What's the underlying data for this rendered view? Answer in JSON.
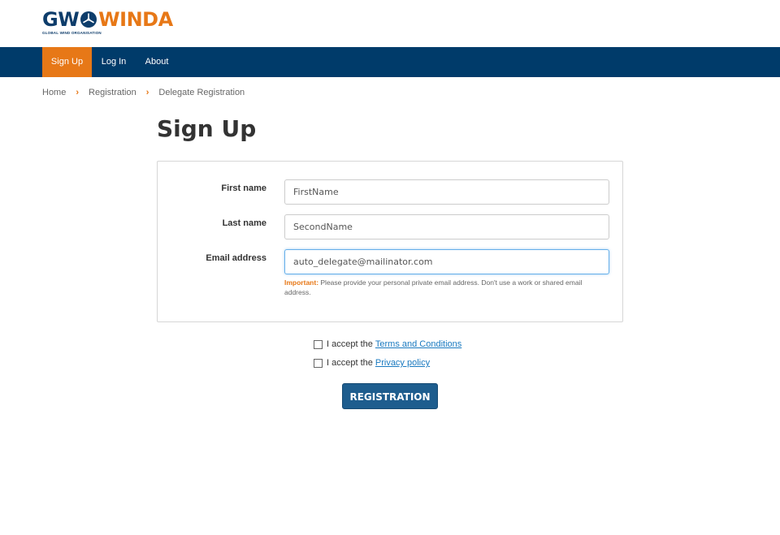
{
  "logo": {
    "part1": "GW",
    "part2": "WINDA",
    "tagline": "GLOBAL WIND ORGANISATION"
  },
  "nav": {
    "items": [
      {
        "label": "Sign Up",
        "active": true
      },
      {
        "label": "Log In",
        "active": false
      },
      {
        "label": "About",
        "active": false
      }
    ]
  },
  "breadcrumb": [
    "Home",
    "Registration",
    "Delegate Registration"
  ],
  "page": {
    "title": "Sign Up"
  },
  "form": {
    "first_name": {
      "label": "First name",
      "value": "FirstName"
    },
    "last_name": {
      "label": "Last name",
      "value": "SecondName"
    },
    "email": {
      "label": "Email address",
      "value": "auto_delegate@mailinator.com"
    },
    "hint_strong": "Important:",
    "hint_text": " Please provide your personal private email address. Don't use a work or shared email address."
  },
  "terms": {
    "prefix": "I accept the",
    "link": "Terms and Conditions",
    "checked": false
  },
  "privacy": {
    "prefix": "I accept the",
    "link": "Privacy policy",
    "checked": false
  },
  "submit_label": "REGISTRATION",
  "colors": {
    "brand_navy": "#003b6a",
    "brand_orange": "#e77817",
    "button": "#1e5d8e",
    "link": "#1a7ac0"
  }
}
